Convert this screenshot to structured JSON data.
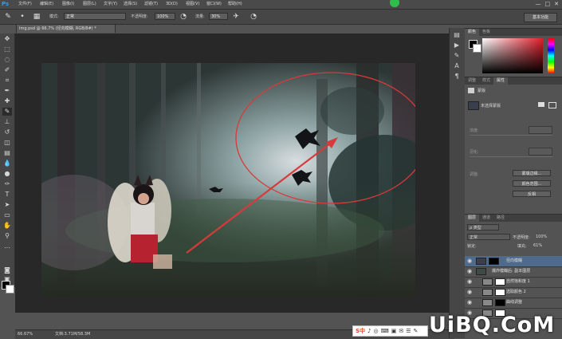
{
  "app": {
    "logo": "Ps",
    "menus": [
      "文件(F)",
      "编辑(E)",
      "图像(I)",
      "图层(L)",
      "文字(Y)",
      "选择(S)",
      "滤镜(T)",
      "3D(D)",
      "视图(V)",
      "窗口(W)",
      "帮助(H)"
    ],
    "window_controls": [
      "—",
      "□",
      "✕"
    ]
  },
  "options": {
    "mode_label": "模式:",
    "mode_value": "正常",
    "opacity_label": "不透明度:",
    "opacity_value": "100%",
    "flow_label": "流量:",
    "flow_value": "30%",
    "workspace": "基本功能"
  },
  "document": {
    "tab_title": "Img.psd @ 66.7% (径向模糊, RGB/8#) *",
    "zoom": "66.67%",
    "doc_size": "文档:3.71M/58.3M"
  },
  "color_panel": {
    "tabs": [
      "颜色",
      "色板"
    ]
  },
  "properties_panel": {
    "tabs": [
      "调整",
      "样式",
      "属性"
    ],
    "header": "蒙版",
    "mask_label": "未选择蒙版",
    "density_label": "浓度:",
    "feather_label": "羽化:",
    "adjust_label": "调整:",
    "btn_edge": "蒙版边缘...",
    "btn_color_range": "颜色范围...",
    "btn_invert": "反相"
  },
  "layers_panel": {
    "tabs": [
      "图层",
      "通道",
      "路径"
    ],
    "kind_label": "ρ 类型",
    "blend_mode": "正常",
    "opacity_label": "不透明度:",
    "opacity_value": "100%",
    "lock_label": "锁定:",
    "fill_label": "填充:",
    "fill_value": "61%",
    "layers": [
      {
        "name": "径向模糊",
        "selected": true
      },
      {
        "name": "爆炸模糊后: 副本图层",
        "selected": false
      },
      {
        "name": "自然饱和度 1",
        "selected": false
      },
      {
        "name": "选取颜色 2",
        "selected": false
      },
      {
        "name": "曲线调整",
        "selected": false
      },
      {
        "name": "",
        "selected": false
      }
    ]
  },
  "ime": {
    "label": "S中",
    "icons": [
      "♪",
      "◎",
      "⌨",
      "▣",
      "✉",
      "☰",
      "✎"
    ]
  },
  "watermark": "UiBQ.CoM",
  "colors": {
    "annotation": "#d83a3a",
    "selected_layer": "#4f6a8a"
  }
}
